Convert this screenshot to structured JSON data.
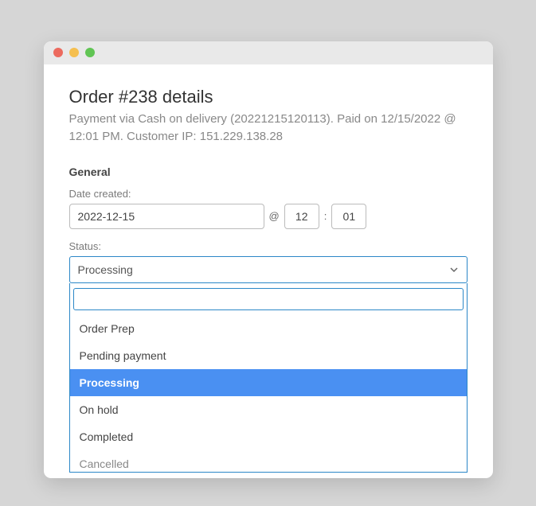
{
  "header": {
    "title": "Order #238 details",
    "subtitle": "Payment via Cash on delivery (20221215120113). Paid on 12/15/2022 @ 12:01 PM. Customer IP: 151.229.138.28"
  },
  "general": {
    "heading": "General",
    "date_label": "Date created:",
    "date_value": "2022-12-15",
    "at_symbol": "@",
    "hour_value": "12",
    "colon": ":",
    "minute_value": "01",
    "status_label": "Status:",
    "status_selected": "Processing",
    "status_options": [
      "Order Prep",
      "Pending payment",
      "Processing",
      "On hold",
      "Completed",
      "Cancelled"
    ]
  }
}
